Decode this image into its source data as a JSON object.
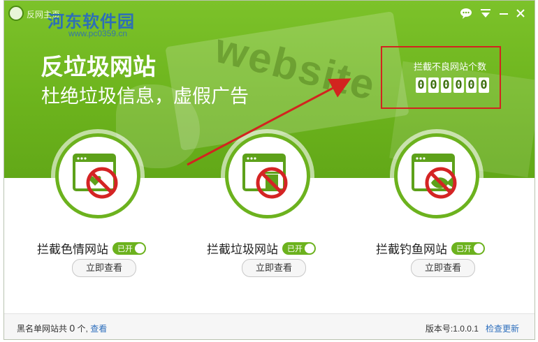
{
  "window": {
    "title": "反网主页"
  },
  "watermark": {
    "text": "河东软件园",
    "url": "www.pc0359.cn"
  },
  "titlebar": {
    "buttons": [
      {
        "name": "chat",
        "icon": "chat-bubble-icon"
      },
      {
        "name": "menu",
        "icon": "dropdown-menu-icon"
      },
      {
        "name": "minimize",
        "icon": "minimize-icon"
      },
      {
        "name": "close",
        "icon": "close-icon"
      }
    ]
  },
  "hero": {
    "headline": "反垃圾网站",
    "subline": "杜绝垃圾信息，虚假广告",
    "background_word": "website"
  },
  "counter": {
    "label": "拦截不良网站个数",
    "digits": [
      "0",
      "0",
      "0",
      "0",
      "0",
      "0"
    ]
  },
  "features": [
    {
      "label": "拦截色情网站",
      "toggle": "已开",
      "button": "立即查看",
      "icon": "blocked-adult-site-icon"
    },
    {
      "label": "拦截垃圾网站",
      "toggle": "已开",
      "button": "立即查看",
      "icon": "blocked-trash-site-icon"
    },
    {
      "label": "拦截钓鱼网站",
      "toggle": "已开",
      "button": "立即查看",
      "icon": "blocked-phishing-site-icon"
    }
  ],
  "footer": {
    "blacklist_prefix": "黑名单网站共",
    "blacklist_count": "0",
    "blacklist_unit": "个,",
    "view_link": "查看",
    "version_label": "版本号:",
    "version": "1.0.0.1",
    "update_link": "检查更新"
  },
  "colors": {
    "brand_green": "#6cb21e",
    "annotation_red": "#d2241f",
    "link_blue": "#2e6fbd"
  }
}
